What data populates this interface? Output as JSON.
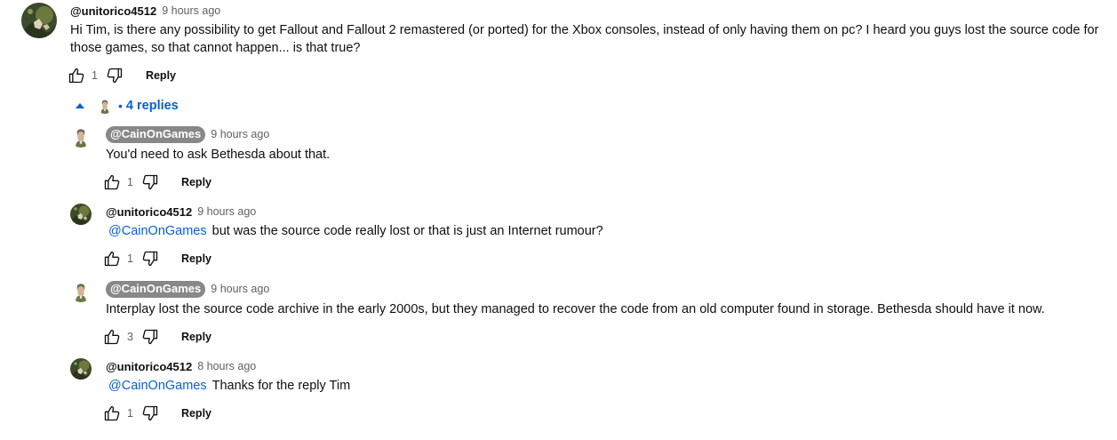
{
  "top_comment": {
    "author": "@unitorico4512",
    "time": "9 hours ago",
    "text": "Hi Tim, is there any possibility to get Fallout and Fallout 2 remastered (or ported) for the Xbox consoles, instead of only having them on pc? I heard you guys lost the source code for those games, so that cannot happen... is that true?",
    "likes": "1",
    "reply_label": "Reply"
  },
  "replies_toggle": {
    "separator": "•",
    "label": "4 replies"
  },
  "replies": [
    {
      "author": "@CainOnGames",
      "is_creator": true,
      "time": "9 hours ago",
      "mention": "",
      "text": "You'd need to ask Bethesda about that.",
      "likes": "1",
      "reply_label": "Reply"
    },
    {
      "author": "@unitorico4512",
      "is_creator": false,
      "time": "9 hours ago",
      "mention": "@CainOnGames",
      "text": "but was the source code really lost or that is just an Internet rumour?",
      "likes": "1",
      "reply_label": "Reply"
    },
    {
      "author": "@CainOnGames",
      "is_creator": true,
      "time": "9 hours ago",
      "mention": "",
      "text": "Interplay lost the source code archive in the early 2000s, but they managed to recover the code from an old computer found in storage. Bethesda should have it now.",
      "likes": "3",
      "reply_label": "Reply"
    },
    {
      "author": "@unitorico4512",
      "is_creator": false,
      "time": "8 hours ago",
      "mention": "@CainOnGames",
      "text": "Thanks for the reply Tim",
      "likes": "1",
      "reply_label": "Reply"
    }
  ],
  "colors": {
    "link": "#065fd4",
    "creator_chip": "#888888",
    "secondary_text": "#606060"
  },
  "icons": {
    "like": "thumb-up-icon",
    "dislike": "thumb-down-icon",
    "collapse": "caret-up-icon"
  }
}
